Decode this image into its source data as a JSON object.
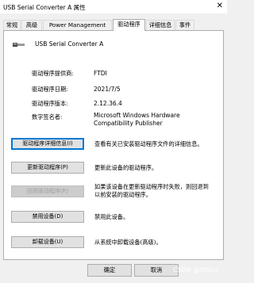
{
  "window": {
    "title": "USB Serial Converter A 属性",
    "close_glyph": "✕"
  },
  "tabs": [
    {
      "label": "常规"
    },
    {
      "label": "高级"
    },
    {
      "label": "Power Management"
    },
    {
      "label": "驱动程序"
    },
    {
      "label": "详细信息"
    },
    {
      "label": "事件"
    }
  ],
  "active_tab": "驱动程序",
  "device": {
    "name": "USB Serial Converter A",
    "icon": "usb-cable-icon"
  },
  "info": {
    "provider_label": "驱动程序提供商:",
    "provider_value": "FTDI",
    "date_label": "驱动程序日期:",
    "date_value": "2021/7/5",
    "version_label": "驱动程序版本:",
    "version_value": "2.12.36.4",
    "signer_label": "数字签名者:",
    "signer_value_line1": "Microsoft Windows Hardware",
    "signer_value_line2": "Compatibility Publisher"
  },
  "actions": [
    {
      "label": "驱动程序详细信息(I)",
      "desc": "查看有关已安装驱动程序文件的详细信息。"
    },
    {
      "label": "更新驱动程序(P)",
      "desc": "更新此设备的驱动程序。"
    },
    {
      "label": "回退驱动程序(R)",
      "desc_line1": "如果该设备在更新驱动程序时失败，则回退到",
      "desc_line2": "以前安装的驱动程序。",
      "disabled": true
    },
    {
      "label": "禁用设备(D)",
      "desc": "禁用此设备。"
    },
    {
      "label": "卸载设备(U)",
      "desc": "从系统中卸载设备(高级)。"
    }
  ],
  "footer": {
    "ok_label": "确定",
    "cancel_label": "取消",
    "watermark": "CSDN @rtttou"
  }
}
